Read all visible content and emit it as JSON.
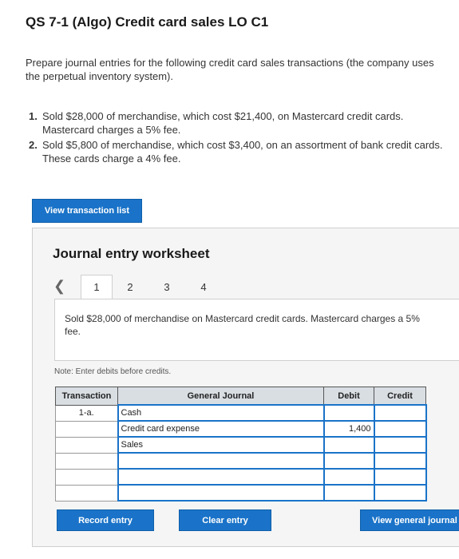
{
  "page": {
    "title": "QS 7-1 (Algo) Credit card sales LO C1",
    "intro": "Prepare journal entries for the following credit card sales transactions (the company uses the perpetual inventory system).",
    "tasks": [
      {
        "num": "1.",
        "text": "Sold $28,000 of merchandise, which cost $21,400, on Mastercard credit cards. Mastercard charges a 5% fee."
      },
      {
        "num": "2.",
        "text": "Sold $5,800 of merchandise, which cost $3,400, on an assortment of bank credit cards. These cards charge a 4% fee."
      }
    ],
    "view_transaction_list": "View transaction list"
  },
  "worksheet": {
    "title": "Journal entry worksheet",
    "pager": {
      "prev_icon": "chevron-left-icon",
      "tabs": [
        "1",
        "2",
        "3",
        "4"
      ],
      "active": 0
    },
    "description": "Sold $28,000 of merchandise on Mastercard credit cards. Mastercard charges a 5% fee.",
    "note": "Note: Enter debits before credits.",
    "table": {
      "headers": {
        "transaction": "Transaction",
        "journal": "General Journal",
        "debit": "Debit",
        "credit": "Credit"
      },
      "rows": [
        {
          "transaction": "1-a.",
          "account": "Cash",
          "debit": "",
          "credit": ""
        },
        {
          "transaction": "",
          "account": "Credit card expense",
          "debit": "1,400",
          "credit": ""
        },
        {
          "transaction": "",
          "account": "Sales",
          "debit": "",
          "credit": ""
        },
        {
          "transaction": "",
          "account": "",
          "debit": "",
          "credit": ""
        },
        {
          "transaction": "",
          "account": "",
          "debit": "",
          "credit": ""
        },
        {
          "transaction": "",
          "account": "",
          "debit": "",
          "credit": ""
        }
      ]
    },
    "buttons": {
      "record": "Record entry",
      "clear": "Clear entry",
      "view_general_journal": "View general journal"
    }
  },
  "colors": {
    "accent": "#1a73c8",
    "header_bg": "#d9dee3",
    "panel_bg": "#f5f5f5"
  }
}
